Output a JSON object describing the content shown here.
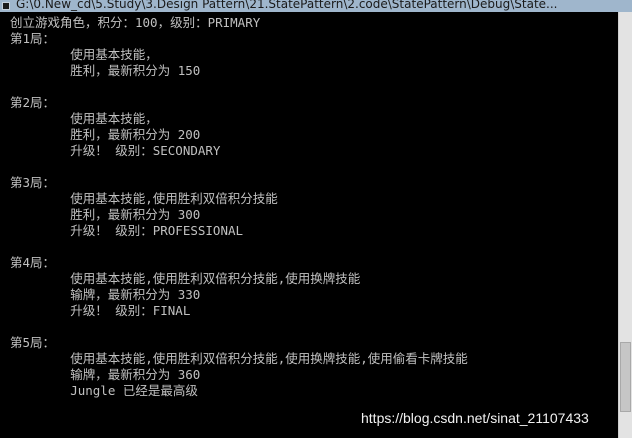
{
  "window": {
    "title": "G:\\0.New_cd\\5.Study\\3.Design Pattern\\21.StatePattern\\2.code\\StatePattern\\Debug\\State..."
  },
  "console": {
    "lines": [
      "创立游戏角色，积分：100，级别：PRIMARY",
      "第1局：",
      "        使用基本技能，",
      "        胜利，最新积分为 150",
      "",
      "第2局：",
      "        使用基本技能，",
      "        胜利，最新积分为 200",
      "        升级！ 级别：SECONDARY",
      "",
      "第3局：",
      "        使用基本技能,使用胜利双倍积分技能",
      "        胜利，最新积分为 300",
      "        升级！ 级别：PROFESSIONAL",
      "",
      "第4局：",
      "        使用基本技能,使用胜利双倍积分技能,使用换牌技能",
      "        输牌，最新积分为 330",
      "        升级！ 级别：FINAL",
      "",
      "第5局：",
      "        使用基本技能,使用胜利双倍积分技能,使用换牌技能,使用偷看卡牌技能",
      "        输牌，最新积分为 360",
      "        Jungle 已经是最高级"
    ]
  },
  "watermark": {
    "text": "https://blog.csdn.net/sinat_21107433"
  },
  "colors": {
    "console_background": "#000000",
    "console_text": "#c0c0c0",
    "titlebar": "#9fb6cc"
  }
}
